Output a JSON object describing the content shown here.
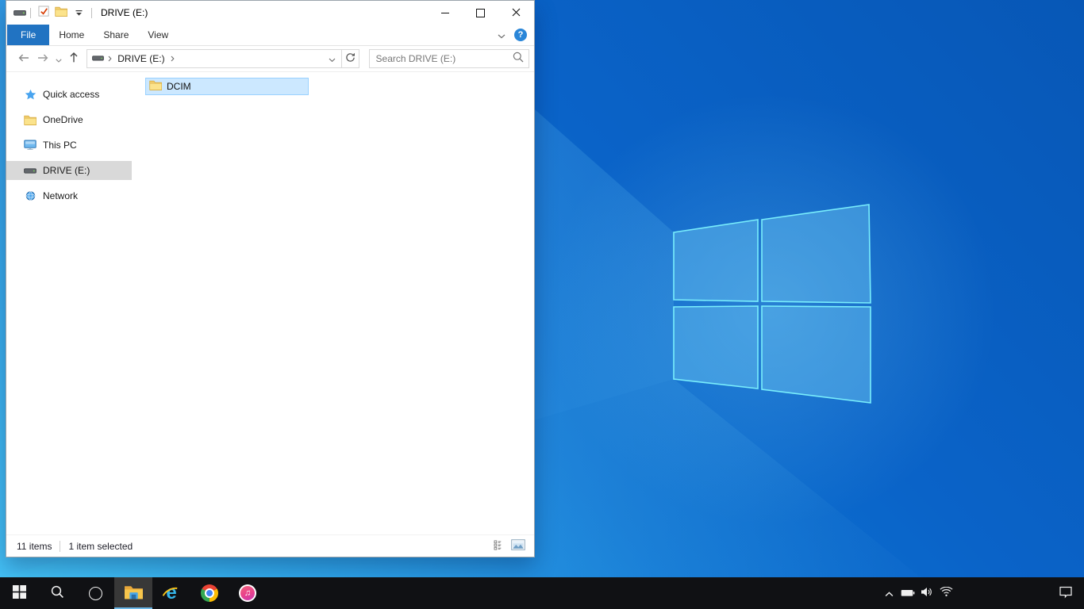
{
  "window": {
    "title": "DRIVE (E:)",
    "quick_access_toolbar_icons": [
      "drive-icon",
      "properties-check-icon",
      "new-folder-icon",
      "customize-qat-dropdown-icon"
    ],
    "ribbon": {
      "tabs": [
        "File",
        "Home",
        "Share",
        "View"
      ],
      "help_icon": "help-question-icon",
      "help_glyph": "?"
    },
    "navigation": {
      "buttons": [
        "back-arrow-icon",
        "forward-arrow-icon",
        "recent-locations-chevron-icon",
        "up-arrow-icon",
        "refresh-icon"
      ],
      "breadcrumb": [
        "DRIVE (E:)"
      ],
      "search_placeholder": "Search DRIVE (E:)"
    },
    "sidebar": {
      "items": [
        {
          "label": "Quick access",
          "icon": "quick-access-star-icon",
          "selected": false
        },
        {
          "label": "OneDrive",
          "icon": "folder-icon",
          "selected": false
        },
        {
          "label": "This PC",
          "icon": "this-pc-monitor-icon",
          "selected": false
        },
        {
          "label": "DRIVE (E:)",
          "icon": "drive-icon",
          "selected": true
        },
        {
          "label": "Network",
          "icon": "network-globe-icon",
          "selected": false
        }
      ]
    },
    "content": {
      "items": [
        {
          "name": "DCIM",
          "icon": "folder-icon",
          "selected": true
        }
      ]
    },
    "statusbar": {
      "item_count": "11 items",
      "selection_text": "1 item selected",
      "view_icons": [
        "details-view-icon",
        "large-thumbnails-view-icon"
      ]
    }
  },
  "taskbar": {
    "buttons": [
      {
        "icon": "start-icon",
        "active": false
      },
      {
        "icon": "search-icon",
        "active": false
      },
      {
        "icon": "cortana-icon",
        "active": false
      },
      {
        "icon": "file-explorer-icon",
        "active": true
      },
      {
        "icon": "internet-explorer-icon",
        "active": false
      },
      {
        "icon": "chrome-icon",
        "active": false
      },
      {
        "icon": "itunes-icon",
        "active": false
      }
    ],
    "tray_icons": [
      "hidden-icons-chevron-icon",
      "battery-icon",
      "volume-icon",
      "wifi-icon",
      "action-center-icon"
    ]
  },
  "colors": {
    "accent_blue": "#2173c2",
    "file_selection_bg": "#cce8ff",
    "file_selection_border": "#99d1ff",
    "sidebar_selected_bg": "#d9d9d9",
    "taskbar_bg": "#101114",
    "taskbar_active_underline": "#6cb8e8",
    "wallpaper_dark": "#0757b6",
    "wallpaper_bright": "#1cb0f2",
    "logo_edge": "#79eefc"
  }
}
